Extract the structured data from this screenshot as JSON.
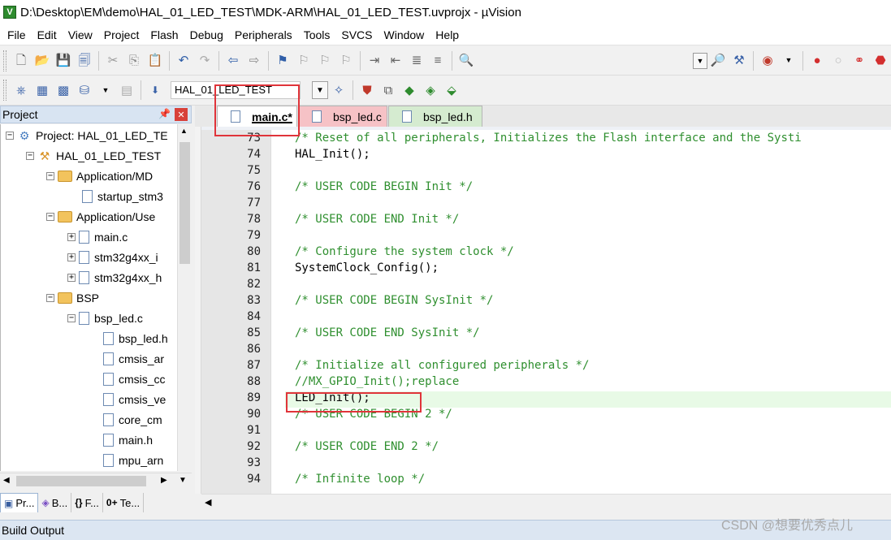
{
  "window": {
    "title": "D:\\Desktop\\EM\\demo\\HAL_01_LED_TEST\\MDK-ARM\\HAL_01_LED_TEST.uvprojx - µVision",
    "app_icon_glyph": "V"
  },
  "menu": [
    "File",
    "Edit",
    "View",
    "Project",
    "Flash",
    "Debug",
    "Peripherals",
    "Tools",
    "SVCS",
    "Window",
    "Help"
  ],
  "toolbar2": {
    "target": "HAL_01_LED_TEST"
  },
  "project_panel": {
    "title": "Project",
    "pin_glyph": "📌",
    "tree": [
      {
        "label": "Project: HAL_01_LED_TE",
        "type": "project",
        "expander": "−"
      },
      {
        "label": "HAL_01_LED_TEST",
        "type": "target",
        "expander": "−"
      },
      {
        "label": "Application/MD",
        "type": "folder",
        "expander": "−"
      },
      {
        "label": "startup_stm3",
        "type": "file",
        "expander": ""
      },
      {
        "label": "Application/Use",
        "type": "folder",
        "expander": "−"
      },
      {
        "label": "main.c",
        "type": "file",
        "expander": "+"
      },
      {
        "label": "stm32g4xx_i",
        "type": "file",
        "expander": "+"
      },
      {
        "label": "stm32g4xx_h",
        "type": "file",
        "expander": "+"
      },
      {
        "label": "BSP",
        "type": "folder",
        "expander": "−"
      },
      {
        "label": "bsp_led.c",
        "type": "file",
        "expander": "−"
      },
      {
        "label": "bsp_led.h",
        "type": "file",
        "expander": ""
      },
      {
        "label": "cmsis_ar",
        "type": "file",
        "expander": ""
      },
      {
        "label": "cmsis_cc",
        "type": "file",
        "expander": ""
      },
      {
        "label": "cmsis_ve",
        "type": "file",
        "expander": ""
      },
      {
        "label": "core_cm",
        "type": "file",
        "expander": ""
      },
      {
        "label": "main.h",
        "type": "file",
        "expander": ""
      },
      {
        "label": "mpu_arn",
        "type": "file",
        "expander": ""
      }
    ]
  },
  "bottom_tabs": [
    {
      "icon": "▣",
      "label": "Pr..."
    },
    {
      "icon": "◈",
      "label": "B..."
    },
    {
      "icon": "{}",
      "label": "F..."
    },
    {
      "icon": "0+",
      "label": "Te..."
    }
  ],
  "editor": {
    "tabs": [
      {
        "label": "main.c*",
        "active": true
      },
      {
        "label": "bsp_led.c",
        "active": false
      },
      {
        "label": "bsp_led.h",
        "active": false
      }
    ],
    "lines": [
      {
        "n": "73",
        "text": "/* Reset of all peripherals, Initializes the Flash interface and the Systi",
        "kind": "comment"
      },
      {
        "n": "74",
        "text": "HAL_Init();",
        "kind": "code"
      },
      {
        "n": "75",
        "text": "",
        "kind": "code"
      },
      {
        "n": "76",
        "text": "/* USER CODE BEGIN Init */",
        "kind": "comment"
      },
      {
        "n": "77",
        "text": "",
        "kind": "code"
      },
      {
        "n": "78",
        "text": "/* USER CODE END Init */",
        "kind": "comment"
      },
      {
        "n": "79",
        "text": "",
        "kind": "code"
      },
      {
        "n": "80",
        "text": "/* Configure the system clock */",
        "kind": "comment"
      },
      {
        "n": "81",
        "text": "SystemClock_Config();",
        "kind": "code"
      },
      {
        "n": "82",
        "text": "",
        "kind": "code"
      },
      {
        "n": "83",
        "text": "/* USER CODE BEGIN SysInit */",
        "kind": "comment"
      },
      {
        "n": "84",
        "text": "",
        "kind": "code"
      },
      {
        "n": "85",
        "text": "/* USER CODE END SysInit */",
        "kind": "comment"
      },
      {
        "n": "86",
        "text": "",
        "kind": "code"
      },
      {
        "n": "87",
        "text": "/* Initialize all configured peripherals */",
        "kind": "comment"
      },
      {
        "n": "88",
        "text": "//MX_GPIO_Init();replace",
        "kind": "comment"
      },
      {
        "n": "89",
        "text": "LED_Init();",
        "kind": "code"
      },
      {
        "n": "90",
        "text": "/* USER CODE BEGIN 2 */",
        "kind": "comment"
      },
      {
        "n": "91",
        "text": "",
        "kind": "code"
      },
      {
        "n": "92",
        "text": "/* USER CODE END 2 */",
        "kind": "comment"
      },
      {
        "n": "93",
        "text": "",
        "kind": "code"
      },
      {
        "n": "94",
        "text": "/* Infinite loop */",
        "kind": "comment"
      }
    ],
    "highlight_line": "89"
  },
  "build_output": {
    "title": "Build Output"
  },
  "watermark": "CSDN @想要优秀点儿",
  "colors": {
    "comment": "#2f8f2f",
    "highlight": "#e0343a",
    "tab_bsp_c": "#f6c2c6",
    "tab_bsp_h": "#d5ebd0"
  }
}
